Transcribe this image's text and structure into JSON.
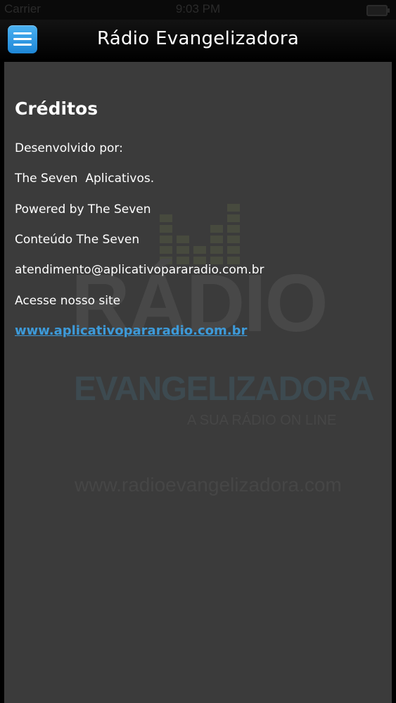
{
  "status_bar": {
    "carrier": "Carrier ",
    "time": "9:03 PM"
  },
  "nav": {
    "title": "Rádio Evangelizadora",
    "menu_icon": "hamburger-menu-icon"
  },
  "credits": {
    "heading": "Créditos",
    "lines": [
      "Desenvolvido por:",
      "The Seven  Aplicativos.",
      "Powered by The Seven",
      "Conteúdo The Seven",
      "atendimento@aplicativopararadio.com.br",
      "Acesse nosso site"
    ],
    "link": "www.aplicativopararadio.com.br"
  },
  "watermark": {
    "radio": "RÁDIO",
    "evangelizadora": "EVANGELIZADORA",
    "slogan": "A SUA RÁDIO ON LINE",
    "site": "www.radioevangelizadora.com"
  },
  "colors": {
    "content_bg": "#3b3b3b",
    "menu_button": "#2f9be6",
    "link": "#3d9ad9"
  }
}
